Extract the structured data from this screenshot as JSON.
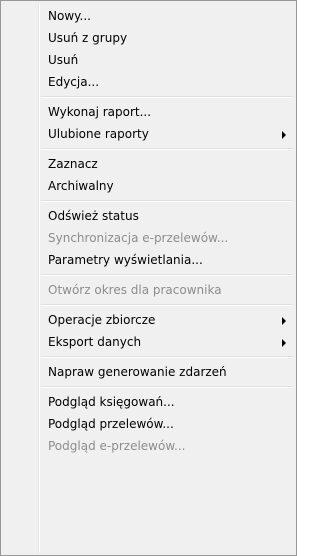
{
  "menu": {
    "items": [
      {
        "label": "Nowy..."
      },
      {
        "label": "Usuń z grupy"
      },
      {
        "label": "Usuń"
      },
      {
        "label": "Edycja..."
      },
      {
        "label": "Wykonaj raport..."
      },
      {
        "label": "Ulubione raporty",
        "submenu": true
      },
      {
        "label": "Zaznacz"
      },
      {
        "label": "Archiwalny"
      },
      {
        "label": "Odśwież status"
      },
      {
        "label": "Synchronizacja e-przelewów...",
        "disabled": true
      },
      {
        "label": "Parametry wyświetlania..."
      },
      {
        "label": "Otwórz okres dla pracownika",
        "disabled": true
      },
      {
        "label": "Operacje zbiorcze",
        "submenu": true
      },
      {
        "label": "Eksport danych",
        "submenu": true
      },
      {
        "label": "Napraw generowanie zdarzeń"
      },
      {
        "label": "Podgląd księgowań..."
      },
      {
        "label": "Podgląd przelewów..."
      },
      {
        "label": "Podgląd e-przelewów...",
        "disabled": true
      }
    ]
  },
  "colors": {
    "background": "#f0f0f0",
    "border": "#979797",
    "text": "#000000",
    "disabled_text": "#8d8d8d"
  }
}
